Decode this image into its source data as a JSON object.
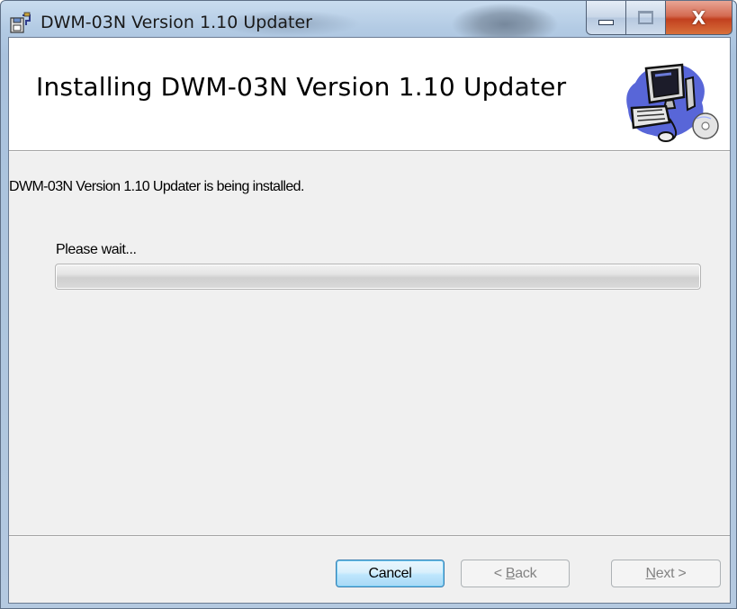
{
  "window": {
    "title": "DWM-03N Version 1.10 Updater",
    "controls": {
      "minimize": "minimize",
      "maximize": "maximize",
      "close": "X"
    }
  },
  "banner": {
    "title": "Installing DWM-03N Version 1.10 Updater",
    "image_icon": "computer-with-cd-icon"
  },
  "body": {
    "status_text": "DWM-03N Version 1.10 Updater is being installed.",
    "wait_label": "Please wait...",
    "progress_fraction": 0
  },
  "footer": {
    "cancel_label": "Cancel",
    "back_prefix": "< ",
    "back_accel": "B",
    "back_rest": "ack",
    "next_accel": "N",
    "next_rest": "ext",
    "next_suffix": " >"
  },
  "colors": {
    "title_bar": "#b3cbe4",
    "close_button": "#c2401f",
    "dialog_background": "#f0f0f0",
    "banner_background": "#ffffff",
    "default_button_border": "#3c7fb1"
  }
}
